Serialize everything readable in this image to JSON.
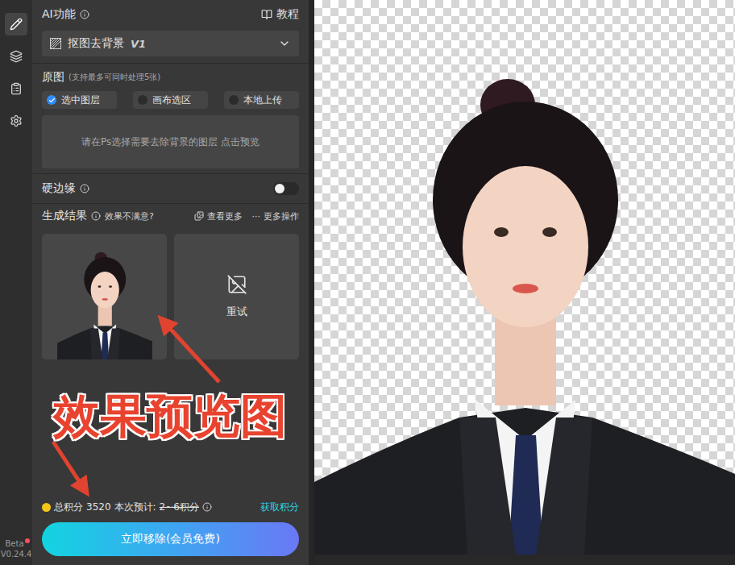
{
  "sidebar": {
    "tools": [
      {
        "selected": true
      },
      {
        "selected": false
      },
      {
        "selected": false
      },
      {
        "selected": false
      }
    ],
    "beta": "Beta",
    "beta_badge": true,
    "version": "V0.24.4"
  },
  "header": {
    "title": "AI功能",
    "tutorial": "教程"
  },
  "function_select": {
    "label": "抠图去背景",
    "version": "V1"
  },
  "source": {
    "title": "原图",
    "hint": "(支持最多可同时处理5张)",
    "options": [
      {
        "label": "选中图层",
        "selected": true
      },
      {
        "label": "画布选区",
        "selected": false
      },
      {
        "label": "本地上传",
        "selected": false
      }
    ],
    "dropzone": "请在Ps选择需要去除背景的图层 点击预览"
  },
  "hard_edge": {
    "label": "硬边缘",
    "on": false
  },
  "results": {
    "title": "生成结果",
    "unsatisfied": "效果不满意?",
    "view_more": "查看更多",
    "more_glyph": "···",
    "more_actions": "更多操作",
    "items": [
      {
        "kind": "preview"
      },
      {
        "kind": "retry",
        "label": "重试"
      }
    ]
  },
  "points": {
    "total_label": "总积分",
    "total": "3520",
    "estimate_label": "本次预计:",
    "estimate": "2~6积分",
    "estimate_struck": true,
    "get": "获取积分"
  },
  "primary_button": {
    "label": "立即移除(会员免费)"
  },
  "annotation": {
    "text": "效果预览图"
  },
  "canvas": {
    "transparent_background": true
  }
}
